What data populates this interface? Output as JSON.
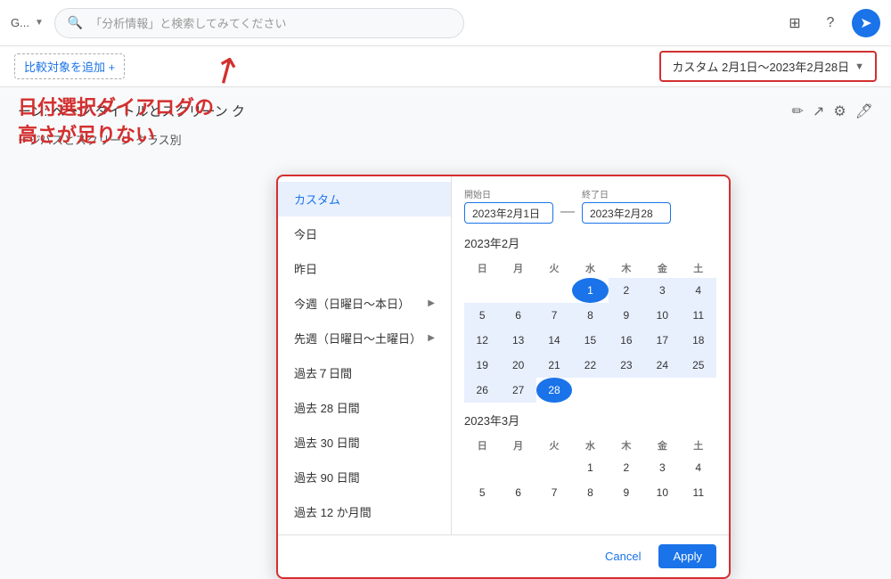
{
  "topbar": {
    "logo_text": "G...",
    "search_placeholder": "「分析情報」と検索してみてください",
    "apps_icon": "⊞",
    "help_icon": "?",
    "profile_icon": "→"
  },
  "secondary_bar": {
    "add_compare_label": "比較対象を追加 +",
    "date_range_label": "カスタム  2月1日〜2023年2月28日",
    "chevron": "▼"
  },
  "page_title": "ーン: ページ タイトルとスクリーン ク",
  "sub_title": "ージパスとスクリーン クラス別",
  "action_icons": [
    "edit-icon",
    "share-icon",
    "settings-icon",
    "pencil-icon"
  ],
  "datepicker": {
    "menu_items": [
      {
        "label": "カスタム",
        "active": true
      },
      {
        "label": "今日",
        "active": false
      },
      {
        "label": "昨日",
        "active": false
      },
      {
        "label": "今週（日曜日〜本日）",
        "active": false,
        "has_arrow": true
      },
      {
        "label": "先週（日曜日〜土曜日）",
        "active": false,
        "has_arrow": true
      },
      {
        "label": "過去７日間",
        "active": false
      },
      {
        "label": "過去 28 日間",
        "active": false
      },
      {
        "label": "過去 30 日間",
        "active": false
      },
      {
        "label": "過去 90 日間",
        "active": false
      },
      {
        "label": "過去 12 か月間",
        "active": false
      }
    ],
    "start_date_label": "開始日",
    "end_date_label": "終了日",
    "start_date_value": "2023年2月1日",
    "end_date_value": "2023年2月28",
    "months": [
      {
        "label": "2023年2月",
        "days_header": [
          "日",
          "月",
          "火",
          "水",
          "木",
          "金",
          "土"
        ],
        "weeks": [
          [
            "",
            "",
            "",
            "1",
            "2",
            "3",
            "4"
          ],
          [
            "5",
            "6",
            "7",
            "8",
            "9",
            "10",
            "11"
          ],
          [
            "12",
            "13",
            "14",
            "15",
            "16",
            "17",
            "18"
          ],
          [
            "19",
            "20",
            "21",
            "22",
            "23",
            "24",
            "25"
          ],
          [
            "26",
            "27",
            "28",
            "",
            "",
            "",
            ""
          ]
        ],
        "start_day": "1",
        "end_day": "28"
      },
      {
        "label": "2023年3月",
        "days_header": [
          "日",
          "月",
          "火",
          "水",
          "木",
          "金",
          "土"
        ],
        "weeks": [
          [
            "",
            "",
            "",
            "1",
            "2",
            "3",
            "4"
          ],
          [
            "5",
            "6",
            "7",
            "8",
            "9",
            "10",
            "11"
          ]
        ]
      }
    ],
    "cancel_label": "Cancel",
    "apply_label": "Apply"
  },
  "annotation": {
    "line1": "日付選択ダイアログの",
    "line2": "高さが足りない"
  }
}
